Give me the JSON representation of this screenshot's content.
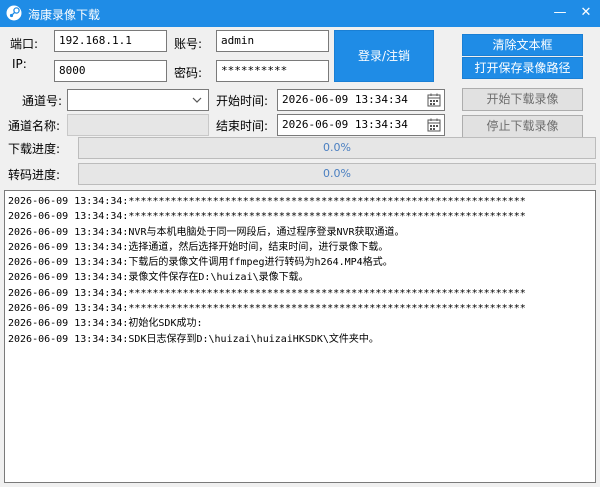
{
  "window": {
    "title": "海康录像下载",
    "minimize_glyph": "—",
    "close_glyph": "✕",
    "icon": "steam-logo-icon"
  },
  "connection": {
    "port_label": "端口:",
    "ip_label": "IP:",
    "ip_value": "192.168.1.1",
    "port_value": "8000",
    "account_label": "账号:",
    "account_value": "admin",
    "password_label": "密码:",
    "password_value": "**********",
    "login_button": "登录/注销"
  },
  "tools": {
    "clear_button": "清除文本框",
    "open_path_button": "打开保存录像路径"
  },
  "channel": {
    "channel_label": "通道号:",
    "channel_value": "",
    "channel_name_label": "通道名称:",
    "channel_name_value": ""
  },
  "time": {
    "start_label": "开始时间:",
    "start_value": "2026-06-09 13:34:34",
    "end_label": "结束时间:",
    "end_value": "2026-06-09 13:34:34"
  },
  "actions": {
    "start_download": "开始下载录像",
    "stop_download": "停止下载录像"
  },
  "progress": {
    "download_label": "下载进度:",
    "download_text": "0.0%",
    "download_value": 0,
    "transcode_label": "转码进度:",
    "transcode_text": "0.0%",
    "transcode_value": 0
  },
  "log": [
    "2026-06-09 13:34:34:******************************************************************",
    "2026-06-09 13:34:34:******************************************************************",
    "2026-06-09 13:34:34:NVR与本机电脑处于同一网段后，通过程序登录NVR获取通道。",
    "2026-06-09 13:34:34:选择通道，然后选择开始时间，结束时间，进行录像下载。",
    "2026-06-09 13:34:34:下载后的录像文件调用ffmpeg进行转码为h264.MP4格式。",
    "2026-06-09 13:34:34:录像文件保存在D:\\huizai\\录像下载。",
    "2026-06-09 13:34:34:******************************************************************",
    "2026-06-09 13:34:34:******************************************************************",
    "2026-06-09 13:34:34:初始化SDK成功:",
    "2026-06-09 13:34:34:SDK日志保存到D:\\huizai\\huizaiHKSDK\\文件夹中。"
  ],
  "colors": {
    "titlebar": "#1f8ce6",
    "button_blue": "#1f8ce6",
    "progress_text": "#4a7fc1"
  }
}
